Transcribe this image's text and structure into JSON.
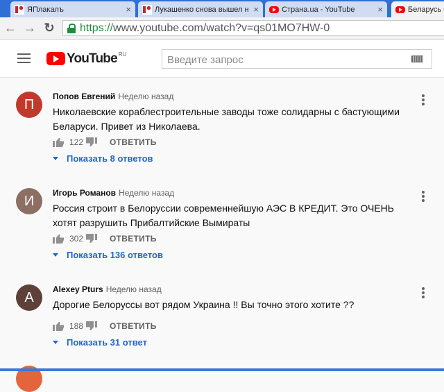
{
  "browser": {
    "tabs": [
      {
        "label": "ЯПлакалъ",
        "icon": "yaplakal-icon",
        "active": false
      },
      {
        "label": "Лукашенко снова вышел н",
        "icon": "yaplakal-icon",
        "active": false
      },
      {
        "label": "Страна.ua - YouTube",
        "icon": "youtube-icon",
        "active": false
      },
      {
        "label": "Беларусь б",
        "icon": "youtube-icon",
        "active": true
      }
    ],
    "close_glyph": "×",
    "url_scheme": "https://",
    "url_rest": "www.youtube.com/watch?v=qs01MO7HW-0"
  },
  "youtube": {
    "logo_text": "YouTube",
    "region": "RU",
    "search_placeholder": "Введите запрос"
  },
  "comments": [
    {
      "initial": "П",
      "avatar_color": "#c0392b",
      "author": "Попов Евгений",
      "time": "Неделю назад",
      "text": "Николаевские кораблестроительные заводы тоже солидарны с бастующими Беларуси. Привет из Николаева.",
      "likes": "122",
      "reply_label": "ОТВЕТИТЬ",
      "show_replies": "Показать 8 ответов"
    },
    {
      "initial": "И",
      "avatar_color": "#8d6e63",
      "author": "Игорь Романов",
      "time": "Неделю назад",
      "text": "Россия строит в Белоруссии современнейшую АЭС В КРЕДИТ. Это ОЧЕНЬ хотят разрушить Прибалтийские Вымираты",
      "likes": "302",
      "reply_label": "ОТВЕТИТЬ",
      "show_replies": "Показать 136 ответов"
    },
    {
      "initial": "A",
      "avatar_color": "#5d4037",
      "author": "Alexey Pturs",
      "time": "Неделю назад",
      "text": "Дорогие Белоруссы вот рядом Украина !! Вы точно этого хотите ??",
      "likes": "188",
      "reply_label": "ОТВЕТИТЬ",
      "show_replies": "Показать 31 ответ"
    }
  ]
}
